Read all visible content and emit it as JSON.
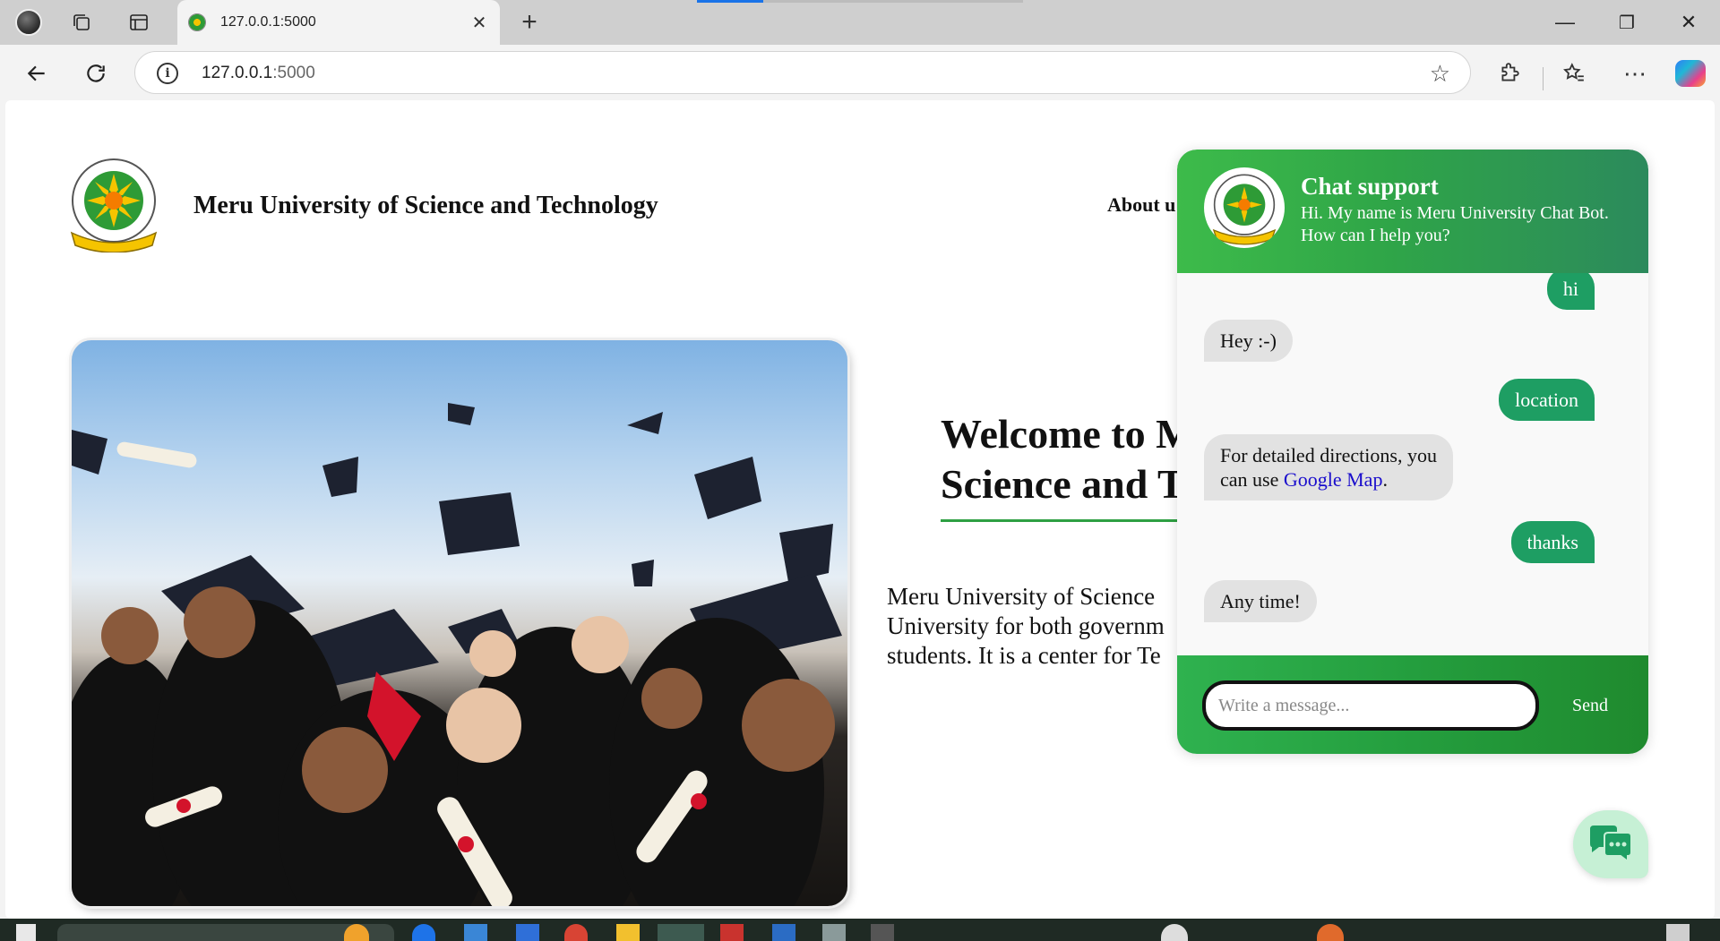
{
  "browser": {
    "tab_title": "127.0.0.1:5000",
    "tab_close": "✕",
    "new_tab": "+",
    "url_host": "127.0.0.1",
    "url_port": ":5000",
    "icons": [
      "profile-icon",
      "workspaces-icon",
      "tab-actions-icon",
      "back-icon",
      "refresh-icon",
      "site-info-icon",
      "favorite-star-icon",
      "extensions-icon",
      "favorites-icon",
      "more-icon",
      "copilot-icon"
    ]
  },
  "window": {
    "minimize": "—",
    "restore": "❐",
    "close": "✕"
  },
  "site": {
    "title": "Meru University of Science and Technology",
    "nav_about": "About u",
    "welcome_line1": "Welcome to M",
    "welcome_line2": "Science and T",
    "intro_line1": "Meru University of Science",
    "intro_line2": "University for both governm",
    "intro_line3": "students. It is a center for Te"
  },
  "chat": {
    "title": "Chat support",
    "greeting": "Hi. My name is Meru University Chat Bot. How can I help you?",
    "messages": [
      {
        "from": "user",
        "text": "hi"
      },
      {
        "from": "bot",
        "text": "Hey :-)"
      },
      {
        "from": "user",
        "text": "location"
      },
      {
        "from": "bot",
        "text_line1": "For detailed directions, you",
        "text_line2": "can use",
        "link": "Google Map",
        "trail": "."
      },
      {
        "from": "user",
        "text": "thanks"
      },
      {
        "from": "bot",
        "text": "Any time!"
      }
    ],
    "input_placeholder": "Write a message...",
    "send_label": "Send"
  },
  "colors": {
    "header_green": "#2fa548",
    "user_bubble": "#1e9e63",
    "bot_bubble": "#e2e2e2",
    "footer_green": "#249e3e",
    "fab_bg": "#c6f0d5",
    "link_blue": "#1a0dcc",
    "rule_green": "#2ea043"
  }
}
